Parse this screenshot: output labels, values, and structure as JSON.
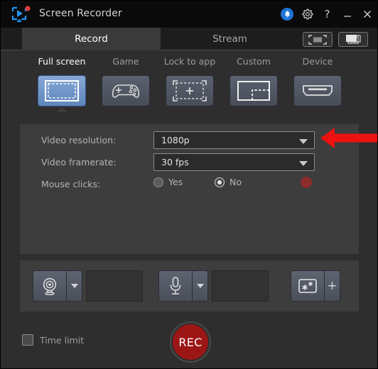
{
  "window": {
    "title": "Screen Recorder",
    "logo_icon": "screen-record-logo-icon",
    "controls": {
      "notification_icon": "bell-icon",
      "settings_icon": "gear-icon",
      "help_label": "?",
      "minimize_label": "minimize-icon",
      "close_label": "close-icon"
    }
  },
  "tabs": [
    {
      "id": "record",
      "label": "Record",
      "active": true
    },
    {
      "id": "stream",
      "label": "Stream",
      "active": false
    }
  ],
  "tab_actions": [
    {
      "id": "screenshot",
      "icon": "screenshot-frame-icon"
    },
    {
      "id": "windows",
      "icon": "stacked-windows-icon"
    }
  ],
  "modes": [
    {
      "id": "full-screen",
      "label": "Full screen",
      "icon": "full-screen-icon",
      "selected": true
    },
    {
      "id": "game",
      "label": "Game",
      "icon": "gamepad-icon",
      "selected": false
    },
    {
      "id": "lock-to-app",
      "label": "Lock to app",
      "icon": "lock-to-app-icon",
      "selected": false
    },
    {
      "id": "custom",
      "label": "Custom",
      "icon": "custom-region-icon",
      "selected": false
    },
    {
      "id": "device",
      "label": "Device",
      "icon": "hdmi-port-icon",
      "selected": false
    }
  ],
  "settings": {
    "resolution": {
      "label": "Video resolution:",
      "value": "1080p"
    },
    "framerate": {
      "label": "Video framerate:",
      "value": "30 fps"
    },
    "mouse_clicks": {
      "label": "Mouse clicks:",
      "yes_label": "Yes",
      "no_label": "No",
      "selected": "No",
      "color": "#8e2b2b"
    }
  },
  "devices": [
    {
      "id": "webcam",
      "icon": "webcam-icon",
      "value": ""
    },
    {
      "id": "microphone",
      "icon": "microphone-icon",
      "value": ""
    },
    {
      "id": "effects",
      "icon": "effects-sparkle-icon",
      "add_label": "+"
    }
  ],
  "footer": {
    "time_limit": {
      "label": "Time limit",
      "checked": false
    },
    "record_button": {
      "label": "REC",
      "color": "#9d1616"
    }
  },
  "annotation": {
    "arrow_color": "#ee1111",
    "points_to": "resolution-dropdown"
  }
}
